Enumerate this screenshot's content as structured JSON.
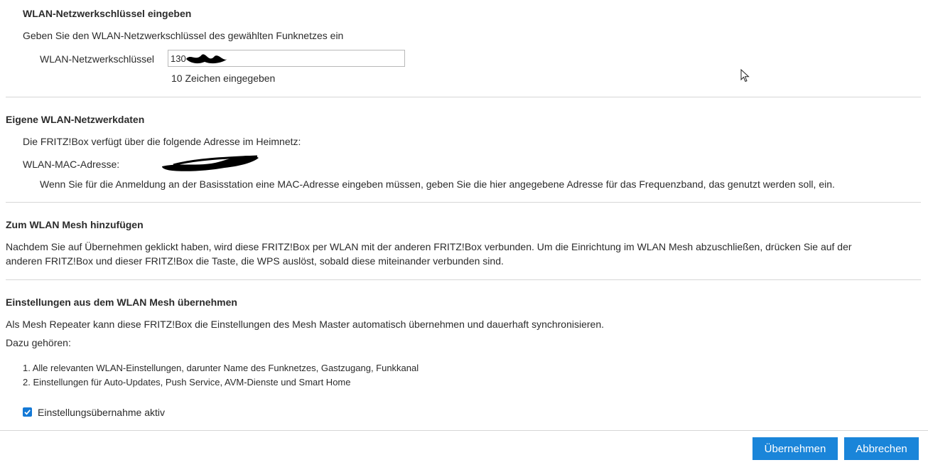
{
  "wlan_key_section": {
    "heading": "WLAN-Netzwerkschlüssel eingeben",
    "description": "Geben Sie den WLAN-Netzwerkschlüssel des gewählten Funknetzes ein",
    "field_label": "WLAN-Netzwerkschlüssel",
    "field_value": "130",
    "char_count": "10 Zeichen eingegeben"
  },
  "own_data_section": {
    "heading": "Eigene WLAN-Netzwerkdaten",
    "description": "Die FRITZ!Box verfügt über die folgende Adresse im Heimnetz:",
    "mac_label": "WLAN-MAC-Adresse:",
    "hint": "Wenn Sie für die Anmeldung an der Basisstation eine MAC-Adresse eingeben müssen, geben Sie die hier angegebene Adresse für das Frequenzband, das genutzt werden soll, ein."
  },
  "mesh_add_section": {
    "heading": "Zum WLAN Mesh hinzufügen",
    "line1": "Nachdem Sie auf Übernehmen geklickt haben, wird diese FRITZ!Box per WLAN mit der anderen FRITZ!Box verbunden. Um die Einrichtung im WLAN Mesh abzuschließen, drücken Sie auf der",
    "line2": "anderen FRITZ!Box und dieser FRITZ!Box die Taste, die WPS auslöst, sobald diese miteinander verbunden sind."
  },
  "mesh_settings_section": {
    "heading": "Einstellungen aus dem WLAN Mesh übernehmen",
    "description": "Als Mesh Repeater kann diese FRITZ!Box die Einstellungen des Mesh Master automatisch übernehmen und dauerhaft synchronisieren.",
    "includes_label": "Dazu gehören:",
    "items": [
      "1. Alle relevanten WLAN-Einstellungen, darunter Name des Funknetzes, Gastzugang, Funkkanal",
      "2. Einstellungen für Auto-Updates, Push Service, AVM-Dienste und Smart Home"
    ],
    "checkbox_label": "Einstellungsübernahme aktiv",
    "checkbox_checked": true
  },
  "buttons": {
    "apply": "Übernehmen",
    "cancel": "Abbrechen"
  },
  "colors": {
    "accent": "#1a85d9",
    "divider": "#d6d6d6",
    "text": "#2b2b2b"
  }
}
